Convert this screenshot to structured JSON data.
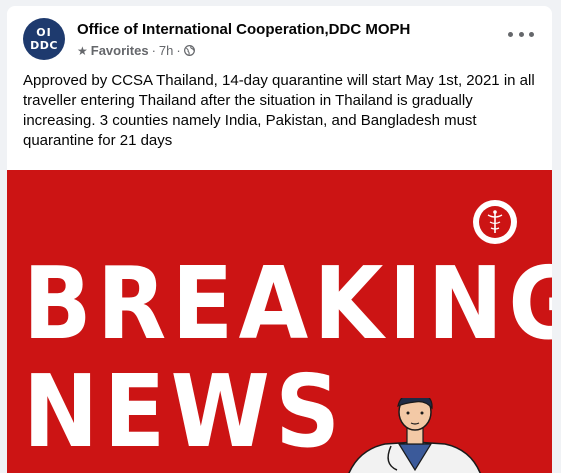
{
  "post": {
    "page_name": "Office of International Cooperation,DDC MOPH",
    "avatar": {
      "line1": "OI",
      "line2": "DDC"
    },
    "favorites_label": "Favorites",
    "time": "7h",
    "separator": "·",
    "text": "Approved by CCSA Thailand, 14-day quarantine will start May 1st, 2021 in all traveller entering Thailand after the situation in Thailand is gradually increasing. 3 counties namely India, Pakistan, and Bangladesh must quarantine for 21 days"
  },
  "image": {
    "background_color": "#cc1414",
    "headline_line1": "BREAKING",
    "headline_line2": "NEWS"
  },
  "icons": {
    "star": "star-icon",
    "globe": "globe-icon",
    "more": "more-icon"
  }
}
